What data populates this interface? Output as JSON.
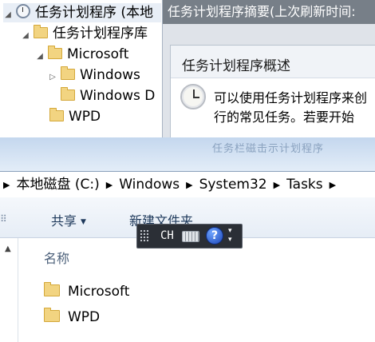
{
  "task_scheduler": {
    "tree": {
      "root_label": "任务计划程序 (本地",
      "library_label": "任务计划程序库",
      "items": [
        {
          "label": "Microsoft"
        },
        {
          "label": "Windows"
        },
        {
          "label": "Windows D"
        },
        {
          "label": "WPD"
        }
      ]
    },
    "summary_title": "任务计划程序摘要(上次刷新时间:",
    "overview_header": "任务计划程序概述",
    "description_line1": "可以使用任务计划程序来创",
    "description_line2": "行的常见任务。若要开始"
  },
  "explorer": {
    "ghost_title": "任务栏磁击示计划程序",
    "breadcrumb": [
      "本地磁盘 (C:)",
      "Windows",
      "System32",
      "Tasks"
    ],
    "toolbar": {
      "share_label": "共享",
      "new_folder_label": "新建文件夹"
    },
    "column_header": "名称",
    "files": [
      {
        "name": "Microsoft",
        "icon": "folder-icon"
      },
      {
        "name": "WPD",
        "icon": "folder-icon"
      }
    ]
  },
  "language_bar": {
    "language": "CH",
    "help_glyph": "?",
    "minimize_glyph": "▾",
    "options_glyph": "▾"
  },
  "colors": {
    "ts_title_bar": "#777f88",
    "explorer_frame": "#c4d7ee",
    "folder": "#f2d481",
    "language_bar": "#2b2f36"
  }
}
